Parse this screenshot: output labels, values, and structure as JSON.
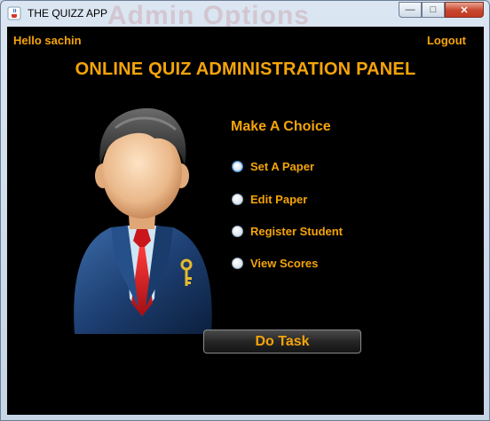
{
  "window": {
    "title": "THE QUIZZ APP",
    "background_ghost_text": "Admin Options"
  },
  "header": {
    "greeting": "Hello sachin",
    "logout_label": "Logout",
    "panel_title": "ONLINE QUIZ ADMINISTRATION PANEL"
  },
  "choices": {
    "heading": "Make A Choice",
    "options": [
      {
        "label": "Set A Paper",
        "selected": true
      },
      {
        "label": "Edit Paper",
        "selected": false
      },
      {
        "label": "Register Student",
        "selected": false
      },
      {
        "label": "View Scores",
        "selected": false
      }
    ]
  },
  "actions": {
    "do_task_label": "Do Task"
  },
  "colors": {
    "accent": "#f5a40a",
    "background": "#000000"
  },
  "icons": {
    "app": "java-coffee-icon",
    "avatar": "admin-businessman-icon"
  }
}
